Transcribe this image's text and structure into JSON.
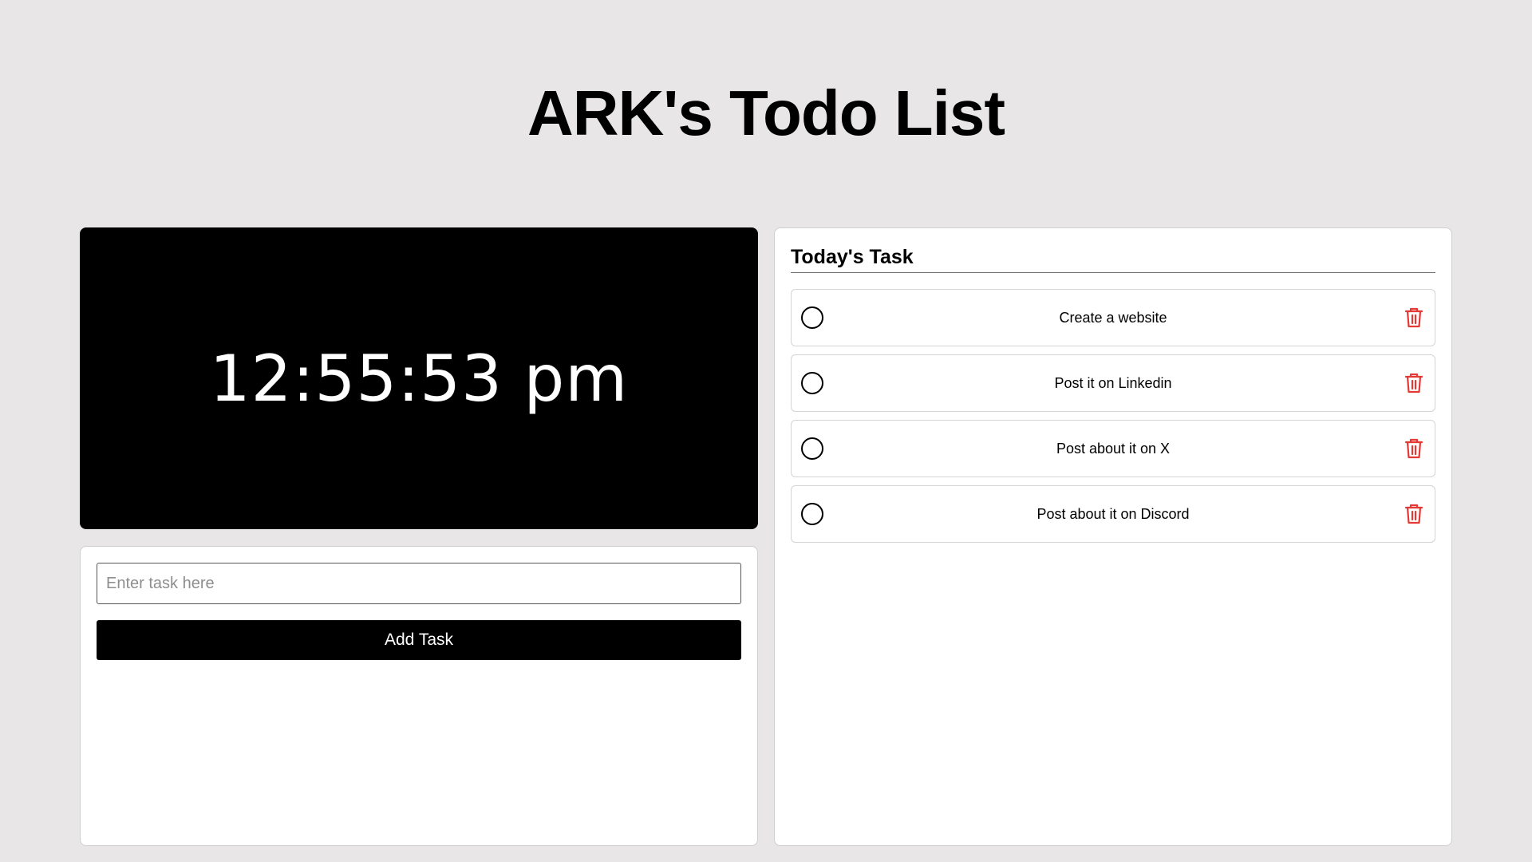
{
  "header": {
    "title": "ARK's Todo List"
  },
  "clock": {
    "time": "12:55:53 pm"
  },
  "add_form": {
    "input_placeholder": "Enter task here",
    "input_value": "",
    "button_label": "Add Task"
  },
  "tasks": {
    "heading": "Today's Task",
    "items": [
      {
        "label": "Create a website",
        "done": false
      },
      {
        "label": "Post it on Linkedin",
        "done": false
      },
      {
        "label": "Post about it on X",
        "done": false
      },
      {
        "label": "Post about it on Discord",
        "done": false
      }
    ]
  },
  "colors": {
    "background": "#e8e6e6",
    "clock_bg": "#000000",
    "delete_icon": "#e53935"
  },
  "icons": {
    "check": "circle-outline",
    "delete": "trash-icon"
  }
}
